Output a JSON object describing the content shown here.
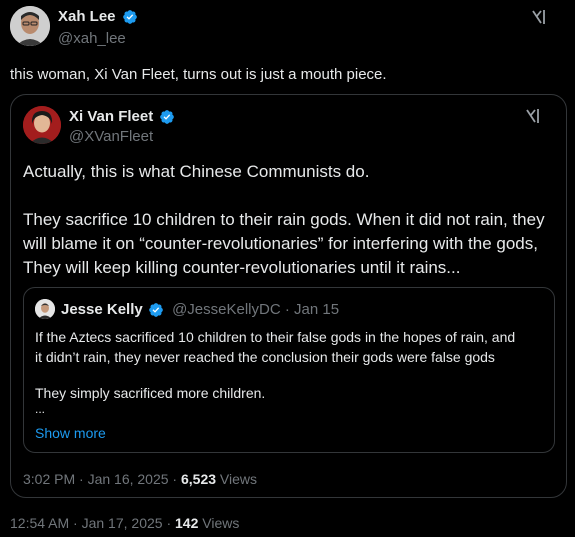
{
  "outer": {
    "author_name": "Xah Lee",
    "author_handle": "@xah_lee",
    "text": "this woman, Xi Van Fleet, turns out is just a mouth piece.",
    "timestamp": "12:54 AM · Jan 17, 2025 · ",
    "views_count": "142",
    "views_label": "Views"
  },
  "quoted": {
    "author_name": "Xi Van Fleet",
    "author_handle": "@XVanFleet",
    "line1": "Actually, this is what Chinese Communists do.",
    "para2_line1": "They sacrifice 10 children to their rain gods. When it did not rain, they",
    "para2_line2": "will blame it on “counter-revolutionaries” for interfering with the gods,",
    "para2_line3": "They will keep killing counter-revolutionaries until it rains...",
    "timestamp": "3:02 PM · Jan 16, 2025 · ",
    "views_count": "6,523",
    "views_label": "Views"
  },
  "nested": {
    "author_name": "Jesse Kelly",
    "meta": "@JesseKellyDC · Jan 15",
    "line1": "If the Aztecs sacrificed 10 children to their false gods in the hopes of rain, and",
    "line2": "it didn’t rain, they never reached the conclusion their gods were false gods",
    "line3": "They simply sacrificed more children.",
    "ellipsis": "...",
    "show_more": "Show more"
  },
  "icons": {
    "grok": "grok-icon",
    "verified": "verified-badge-icon"
  },
  "colors": {
    "background": "#000000",
    "text": "#e7e9ea",
    "muted": "#71767b",
    "accent": "#1d9bf0",
    "border": "#333639"
  }
}
